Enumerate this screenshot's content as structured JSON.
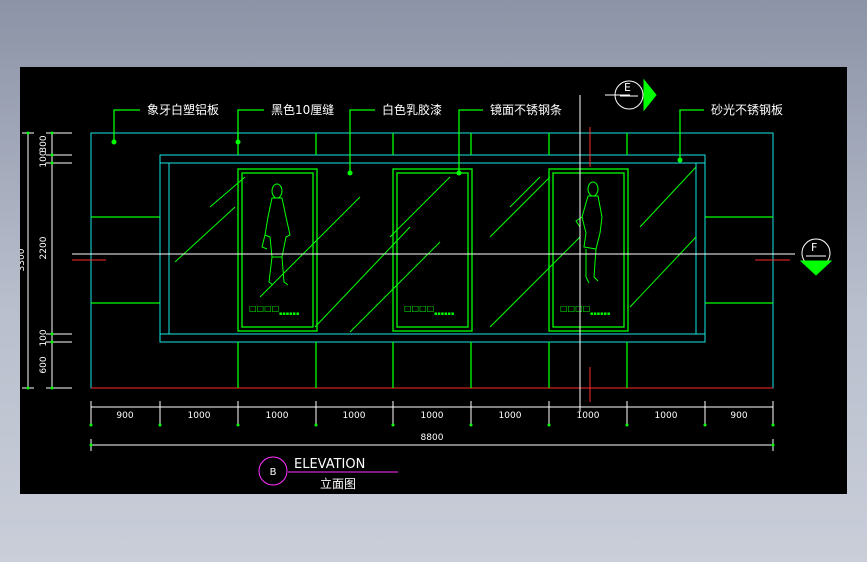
{
  "callouts": [
    {
      "text": "象牙白塑铝板"
    },
    {
      "text": "黑色10厘缝"
    },
    {
      "text": "白色乳胶漆"
    },
    {
      "text": "镜面不锈钢条"
    },
    {
      "text": "砂光不锈钢板"
    }
  ],
  "dims_bottom": [
    "900",
    "1000",
    "1000",
    "1000",
    "1000",
    "1000",
    "1000",
    "1000",
    "900"
  ],
  "dim_total_bottom": "8800",
  "dims_left": [
    "300",
    "100",
    "2200",
    "100",
    "600"
  ],
  "dim_total_left": "3300",
  "section_marks": {
    "top": "E",
    "right": "F"
  },
  "panel_marks": [
    "□□□□",
    "□□□□",
    "□□□□"
  ],
  "panel_small": [
    "▪▪▪▪▪▪",
    "▪▪▪▪▪▪",
    "▪▪▪▪▪▪"
  ],
  "title": {
    "circle": "B",
    "en": "ELEVATION",
    "cn": "立面图"
  },
  "colors": {
    "frame": "#00ff00",
    "inner": "#18e6e6",
    "axis": "#ff2a2a",
    "title": "#ff33ff",
    "background": "#000000"
  }
}
